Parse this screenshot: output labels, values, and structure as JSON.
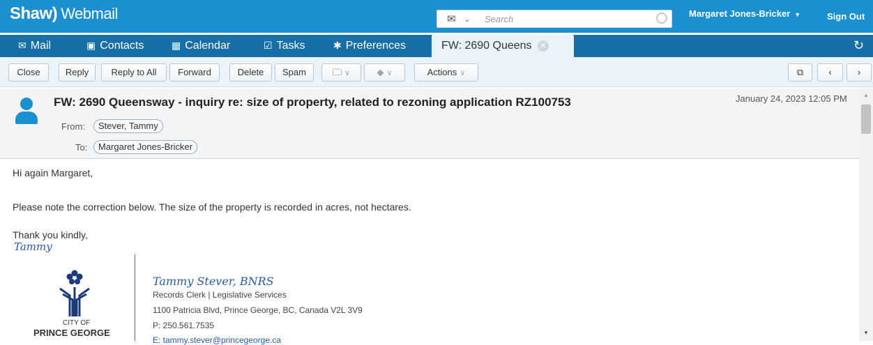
{
  "header": {
    "brand": "Shaw)",
    "app_name": "Webmail",
    "search_placeholder": "Search",
    "user_name": "Margaret Jones-Bricker",
    "sign_out": "Sign Out"
  },
  "nav": {
    "items": [
      {
        "label": "Mail",
        "icon": "mail-icon"
      },
      {
        "label": "Contacts",
        "icon": "contacts-icon"
      },
      {
        "label": "Calendar",
        "icon": "calendar-icon"
      },
      {
        "label": "Tasks",
        "icon": "tasks-icon"
      },
      {
        "label": "Preferences",
        "icon": "gear-icon"
      }
    ],
    "active_tab": "FW: 2690 Queens"
  },
  "toolbar": {
    "close": "Close",
    "reply": "Reply",
    "reply_all": "Reply to All",
    "forward": "Forward",
    "delete": "Delete",
    "spam": "Spam",
    "actions": "Actions"
  },
  "message": {
    "subject": "FW: 2690 Queensway - inquiry re: size of property, related to rezoning application RZ100753",
    "date": "January 24, 2023 12:05 PM",
    "from_label": "From:",
    "from": "Stever, Tammy",
    "to_label": "To:",
    "to": "Margaret Jones-Bricker",
    "greeting": "Hi again Margaret,",
    "paragraph": "Please note the correction below.  The size of the property is recorded in acres, not hectares.",
    "closing": "Thank you kindly,",
    "sign_name": "Tammy"
  },
  "signature": {
    "name": "Tammy Stever, BNRS",
    "title": "Records Clerk | Legislative Services",
    "address": "1100 Patricia Blvd, Prince George, BC, Canada V2L 3V9",
    "phone": "P: 250.561.7535",
    "email": "E: tammy.stever@princegeorge.ca",
    "logo_small": "CITY OF",
    "logo_main": "PRINCE GEORGE"
  },
  "colors": {
    "header_blue": "#1b8fd0",
    "nav_blue": "#176fa6",
    "toolbar_bg": "#eaf3fa"
  }
}
